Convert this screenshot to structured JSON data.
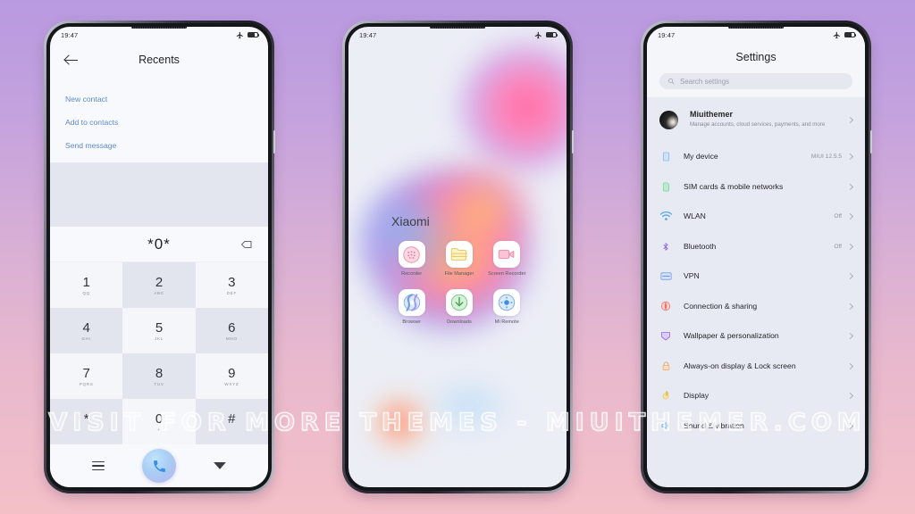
{
  "watermark": "VISIT FOR MORE THEMES - MIUITHEMER.COM",
  "colors": {
    "bg_top": "#b999e0",
    "bg_bottom": "#f4c0c8",
    "link_blue": "#5b8bd0",
    "accent_call": "#3a8ee6"
  },
  "status_bar": {
    "time": "19:47",
    "airplane_icon": "airplane-icon",
    "battery_icon": "battery-icon"
  },
  "phone_dialer": {
    "header": {
      "back_icon": "back-arrow-icon",
      "title": "Recents"
    },
    "links": [
      {
        "label": "New contact",
        "name": "new-contact"
      },
      {
        "label": "Add to contacts",
        "name": "add-to-contacts"
      },
      {
        "label": "Send message",
        "name": "send-message"
      }
    ],
    "input": {
      "value": "*0*",
      "delete_icon": "backspace-icon"
    },
    "keys": [
      {
        "digit": "1",
        "letters": "QQ"
      },
      {
        "digit": "2",
        "letters": "ABC"
      },
      {
        "digit": "3",
        "letters": "DEF"
      },
      {
        "digit": "4",
        "letters": "GHI"
      },
      {
        "digit": "5",
        "letters": "JKL"
      },
      {
        "digit": "6",
        "letters": "MNO"
      },
      {
        "digit": "7",
        "letters": "PQRS"
      },
      {
        "digit": "8",
        "letters": "TUV"
      },
      {
        "digit": "9",
        "letters": "WXYZ"
      },
      {
        "digit": "*",
        "letters": ""
      },
      {
        "digit": "0",
        "letters": "+"
      },
      {
        "digit": "#",
        "letters": ""
      }
    ],
    "bottom_bar": {
      "menu_icon": "menu-icon",
      "call_icon": "call-icon",
      "collapse_icon": "chevron-down-icon"
    }
  },
  "phone_home": {
    "folder_title": "Xiaomi",
    "apps": [
      {
        "label": "Recorder",
        "icon": "recorder-icon"
      },
      {
        "label": "File Manager",
        "icon": "file-manager-icon"
      },
      {
        "label": "Screen Recorder",
        "icon": "screen-recorder-icon"
      },
      {
        "label": "Browser",
        "icon": "browser-icon"
      },
      {
        "label": "Downloads",
        "icon": "downloads-icon"
      },
      {
        "label": "Mi Remote",
        "icon": "mi-remote-icon"
      }
    ]
  },
  "phone_settings": {
    "title": "Settings",
    "search": {
      "placeholder": "Search settings",
      "icon": "search-icon"
    },
    "account": {
      "name": "Miuithemer",
      "subtitle": "Manage accounts, cloud services, payments, and more",
      "avatar": "avatar"
    },
    "items": [
      {
        "label": "My device",
        "value": "MIUI 12.5.5",
        "icon": "phone-icon",
        "color": "#7fb0f0"
      },
      {
        "label": "SIM cards & mobile networks",
        "value": "",
        "icon": "sim-icon",
        "color": "#6fd39a"
      },
      {
        "label": "WLAN",
        "value": "Off",
        "icon": "wifi-icon",
        "color": "#5aa8ef"
      },
      {
        "label": "Bluetooth",
        "value": "Off",
        "icon": "bluetooth-icon",
        "color": "#9a6ae0"
      },
      {
        "label": "VPN",
        "value": "",
        "icon": "vpn-icon",
        "color": "#7da2e6"
      },
      {
        "label": "Connection & sharing",
        "value": "",
        "icon": "connection-sharing-icon",
        "color": "#e8736f"
      },
      {
        "label": "Wallpaper & personalization",
        "value": "",
        "icon": "wallpaper-icon",
        "color": "#9a6ae0"
      },
      {
        "label": "Always-on display & Lock screen",
        "value": "",
        "icon": "lock-icon",
        "color": "#f0a45e"
      },
      {
        "label": "Display",
        "value": "",
        "icon": "brightness-icon",
        "color": "#e8c45e"
      },
      {
        "label": "Sound & vibration",
        "value": "",
        "icon": "sound-icon",
        "color": "#5aa8ef"
      }
    ]
  }
}
